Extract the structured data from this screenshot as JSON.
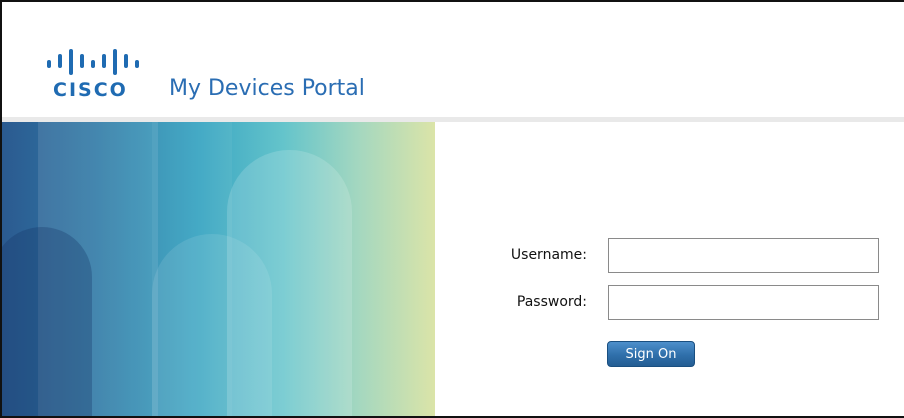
{
  "header": {
    "logo_text": "CISCO",
    "portal_title": "My Devices Portal",
    "brand_color": "#1f6bb2"
  },
  "login_form": {
    "username_label": "Username:",
    "username_value": "",
    "password_label": "Password:",
    "password_value": "",
    "sign_on_label": "Sign On"
  },
  "icons": {
    "logo": "cisco-logo-icon"
  }
}
